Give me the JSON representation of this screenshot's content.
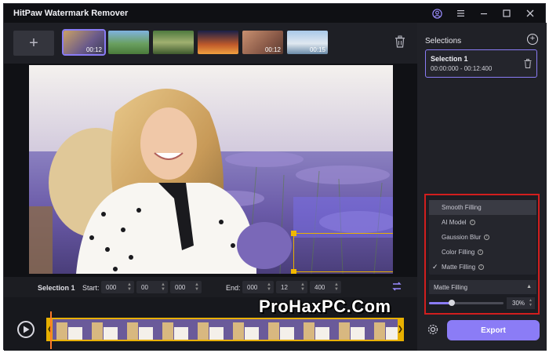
{
  "app": {
    "title": "HitPaw Watermark Remover"
  },
  "titlebar": {
    "icons": [
      "user-icon",
      "menu-icon",
      "minimize-icon",
      "maximize-icon",
      "close-icon"
    ]
  },
  "thumbnails": [
    {
      "time": "00:12",
      "active": true
    },
    {
      "time": ""
    },
    {
      "time": ""
    },
    {
      "time": ""
    },
    {
      "time": "00:12"
    },
    {
      "time": "00:15"
    }
  ],
  "selection_row": {
    "label": "Selection 1",
    "start_label": "Start:",
    "start": [
      "000",
      "00",
      "000"
    ],
    "end_label": "End:",
    "end": [
      "000",
      "12",
      "400"
    ]
  },
  "selections": {
    "title": "Selections",
    "items": [
      {
        "name": "Selection 1",
        "range": "00:00:000 - 00:12:400"
      }
    ]
  },
  "fill_modes": {
    "options": [
      {
        "label": "Smooth Filling",
        "info": false,
        "checked": false,
        "highlighted": true
      },
      {
        "label": "AI Model",
        "info": true,
        "checked": false
      },
      {
        "label": "Gaussion Blur",
        "info": true,
        "checked": false
      },
      {
        "label": "Color Filling",
        "info": true,
        "checked": false
      },
      {
        "label": "Matte Filling",
        "info": true,
        "checked": true
      }
    ],
    "selected": "Matte Filling",
    "opacity_value": "30%",
    "opacity_fraction": 0.3
  },
  "export_label": "Export",
  "watermark_text": "ProHaxPC.Com",
  "colors": {
    "accent": "#8b7cf6",
    "highlight_border": "#d11e1e",
    "handle": "#f0b800",
    "playhead": "#ff7a2a"
  }
}
